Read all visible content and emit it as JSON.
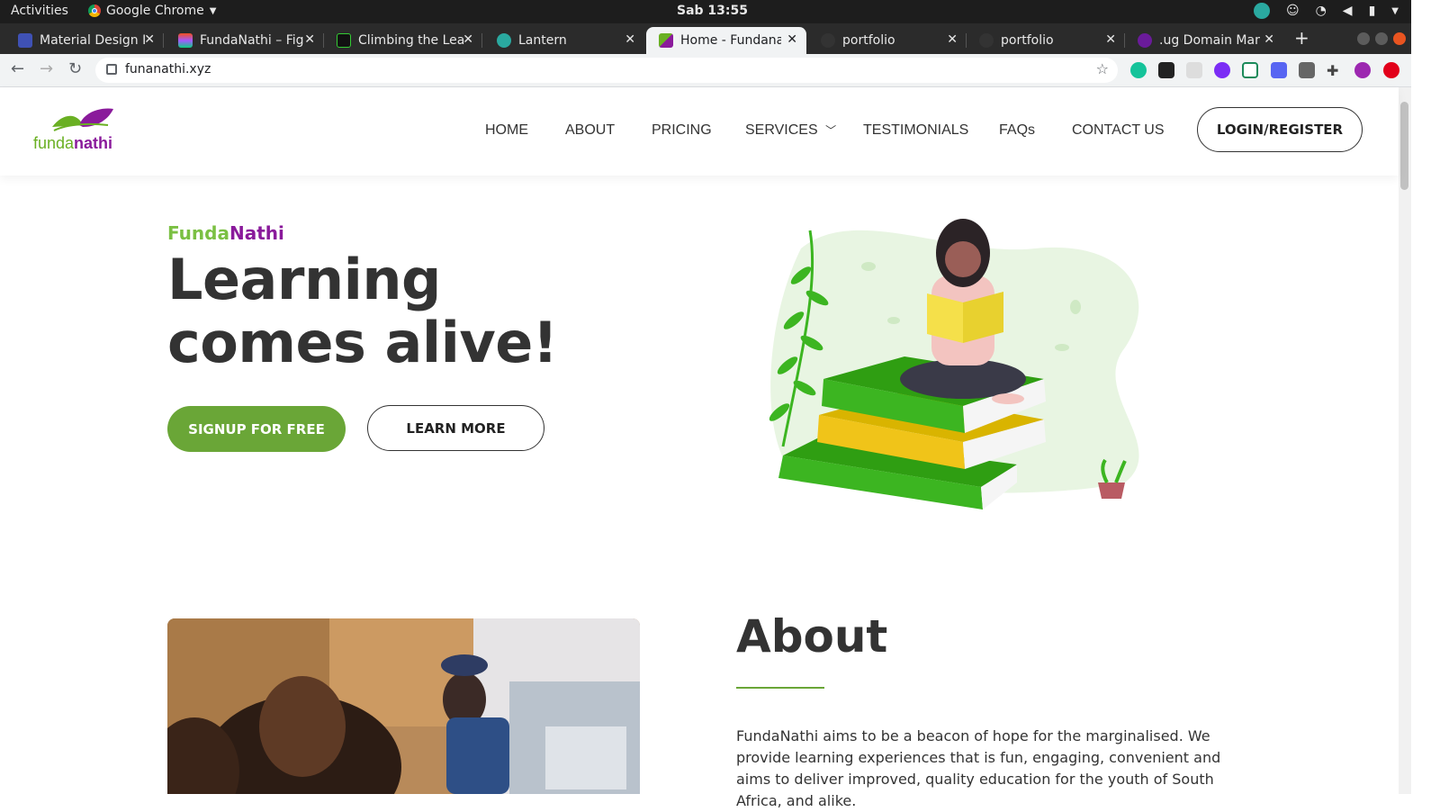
{
  "os_bar": {
    "activities": "Activities",
    "app_name": "Google Chrome",
    "clock": "Sab 13:55"
  },
  "browser": {
    "tabs": [
      {
        "label": "Material Design I",
        "icon": "material-design-icon",
        "color": "#3f51b5"
      },
      {
        "label": "FundaNathi – Fig",
        "icon": "figma-icon",
        "color": "#f24e1e"
      },
      {
        "label": "Climbing the Lea",
        "icon": "hashnode-icon",
        "color": "#111111"
      },
      {
        "label": "Lantern",
        "icon": "lantern-icon",
        "color": "#2aa9a0"
      },
      {
        "label": "Home - Fundanat",
        "icon": "fundanathi-icon",
        "color": "#6ab023",
        "active": true
      },
      {
        "label": "portfolio",
        "icon": "github-icon",
        "color": "#333333"
      },
      {
        "label": "portfolio",
        "icon": "github-icon",
        "color": "#333333"
      },
      {
        "label": ".ug Domain Man",
        "icon": "domain-icon",
        "color": "#6a1b9a"
      }
    ],
    "new_tab": "+",
    "url": "funanathi.xyz"
  },
  "site": {
    "logo": {
      "funda": "funda",
      "nathi": "nathi"
    },
    "nav": {
      "home": "HOME",
      "about": "ABOUT",
      "pricing": "PRICING",
      "services": "SERVICES",
      "testimonials": "TESTIMONIALS",
      "faqs": "FAQs",
      "contact": "CONTACT US",
      "login": "LOGIN/REGISTER"
    },
    "hero": {
      "eyebrow_a": "Funda",
      "eyebrow_b": "Nathi",
      "headline_line1": "Learning",
      "headline_line2": "comes alive!",
      "signup": "SIGNUP FOR FREE",
      "learn_more": "LEARN MORE"
    },
    "about": {
      "title": "About",
      "text": "FundaNathi aims to be a beacon of hope for the marginalised. We provide learning experiences that is fun, engaging, convenient and aims to deliver improved, quality education for the youth of South Africa, and alike."
    }
  },
  "colors": {
    "brand_green": "#6aa637",
    "brand_purple": "#8a1a9b",
    "text_dark": "#333333"
  }
}
